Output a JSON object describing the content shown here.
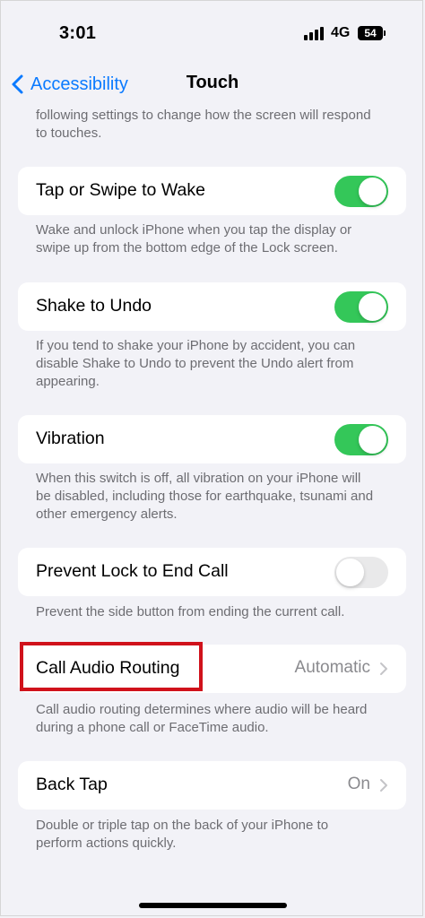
{
  "status_bar": {
    "time": "3:01",
    "network": "4G",
    "battery": "54"
  },
  "nav": {
    "back_label": "Accessibility",
    "title": "Touch"
  },
  "intro_text": "following settings to change how the screen will respond to touches.",
  "settings": [
    {
      "label": "Tap or Swipe to Wake",
      "toggle": "on",
      "description": "Wake and unlock iPhone when you tap the display or swipe up from the bottom edge of the Lock screen."
    },
    {
      "label": "Shake to Undo",
      "toggle": "on",
      "description": "If you tend to shake your iPhone by accident, you can disable Shake to Undo to prevent the Undo alert from appearing."
    },
    {
      "label": "Vibration",
      "toggle": "on",
      "description": "When this switch is off, all vibration on your iPhone will be disabled, including those for earthquake, tsunami and other emergency alerts."
    },
    {
      "label": "Prevent Lock to End Call",
      "toggle": "off",
      "description": "Prevent the side button from ending the current call."
    },
    {
      "label": "Call Audio Routing",
      "value": "Automatic",
      "description": "Call audio routing determines where audio will be heard during a phone call or FaceTime audio."
    },
    {
      "label": "Back Tap",
      "value": "On",
      "description": "Double or triple tap on the back of your iPhone to perform actions quickly."
    }
  ],
  "colors": {
    "accent": "#0a7aff",
    "toggle_on": "#34c759",
    "toggle_off": "#e9e9ea",
    "highlight": "#d0121b",
    "background": "#f2f2f7"
  }
}
